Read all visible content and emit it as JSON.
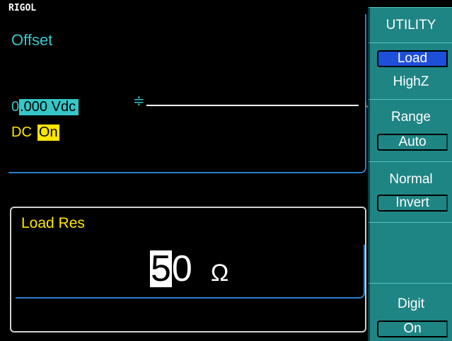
{
  "brand": "RIGOL",
  "channel": {
    "param_name": "Offset",
    "value_lead": "0",
    "value_highlight": ".000 Vdc",
    "dc_label": "DC",
    "dc_state": "On",
    "marker_glyph": "≑",
    "trace_end_glyph": "↳"
  },
  "input": {
    "label": "Load Res",
    "cursor_digit": "5",
    "rest_digits": "0",
    "unit": "Ω"
  },
  "menu": {
    "title": "UTILITY",
    "load_selected": "Load",
    "load_option": "HighZ",
    "range_label": "Range",
    "range_value": "Auto",
    "polarity_label": "Normal",
    "polarity_value": "Invert",
    "digit_label": "Digit",
    "digit_value": "On"
  },
  "colors": {
    "cyan": "#37c6c8",
    "yellow": "#ffe600",
    "teal": "#1f8584",
    "blue": "#1e4fd8",
    "border_blue": "#2b7fc8"
  }
}
